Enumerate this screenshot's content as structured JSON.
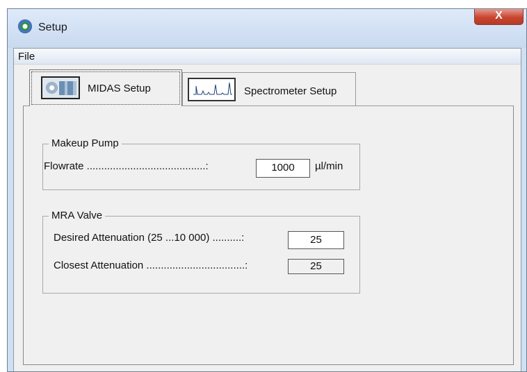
{
  "window": {
    "title": "Setup",
    "close_label": "X"
  },
  "menu": {
    "items": [
      {
        "label": "File"
      }
    ]
  },
  "tabs": [
    {
      "label": "MIDAS Setup",
      "icon": "midas-icon",
      "active": true
    },
    {
      "label": "Spectrometer Setup",
      "icon": "spectrum-icon",
      "active": false
    }
  ],
  "makeup_pump": {
    "title": "Makeup Pump",
    "flowrate": {
      "label": "Flowrate .........................................:",
      "value": "1000",
      "unit": "µl/min"
    }
  },
  "mra_valve": {
    "title": "MRA Valve",
    "desired": {
      "label": "Desired Attenuation (25 ...10 000) ..........:",
      "value": "25"
    },
    "closest": {
      "label": "Closest Attenuation ..................................:",
      "value": "25"
    }
  }
}
